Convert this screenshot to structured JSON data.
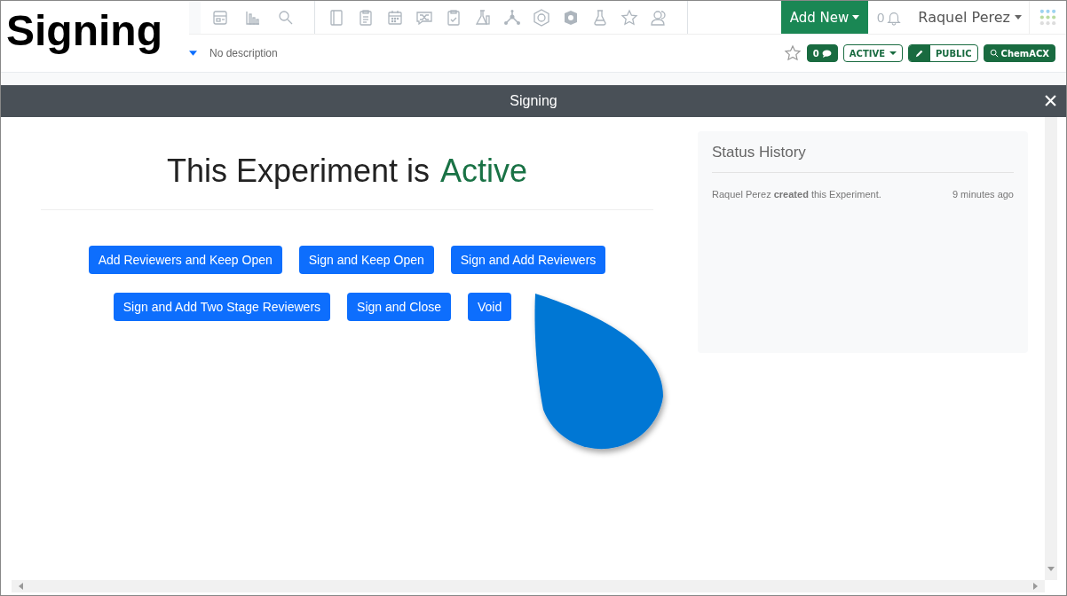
{
  "caption": "Signing",
  "header": {
    "description": "No description",
    "add_new": "Add New",
    "notifications": "0",
    "user": "Raquel Perez"
  },
  "toolbar": {
    "comments": "0",
    "status": "ACTIVE",
    "visibility": "PUBLIC",
    "search_button": "ChemACX"
  },
  "modal": {
    "title": "Signing",
    "heading_prefix": "This Experiment is",
    "heading_status": "Active",
    "button_rows": [
      {
        "buttons": [
          "Add Reviewers and Keep Open",
          "Sign and Keep Open",
          "Sign and Add Reviewers"
        ]
      },
      {
        "buttons": [
          "Sign and Add Two Stage Reviewers",
          "Sign and Close",
          "Void"
        ]
      }
    ],
    "status_history": {
      "title": "Status History",
      "entries": [
        {
          "text": "Raquel Perez **created** this Experiment.",
          "time": "9 minutes ago"
        }
      ]
    }
  }
}
